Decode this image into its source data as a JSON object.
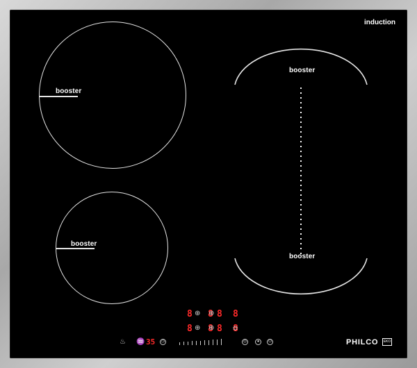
{
  "cooktop": {
    "header_label": "induction",
    "zones": {
      "top_left": {
        "label": "booster"
      },
      "bottom_left": {
        "label": "booster"
      },
      "flex_top": {
        "label": "booster"
      },
      "flex_bottom": {
        "label": "booster"
      }
    },
    "displays": {
      "row1": [
        "8",
        "8",
        "8",
        "8"
      ],
      "row2": [
        "8",
        "8",
        "8",
        "8"
      ],
      "timer": "35"
    },
    "brand": "PHILCO",
    "brand_box": "EKO",
    "colors": {
      "glass": "#000000",
      "frame": "#b5b5b5",
      "display_red": "#ff2a2a",
      "zone_line": "#e6e6e6"
    },
    "icons": [
      "pan-icon",
      "pot-icon",
      "clock-icon",
      "lock-icon",
      "power-icon",
      "info-icon",
      "bridge-icon",
      "zone-select-icon"
    ]
  }
}
